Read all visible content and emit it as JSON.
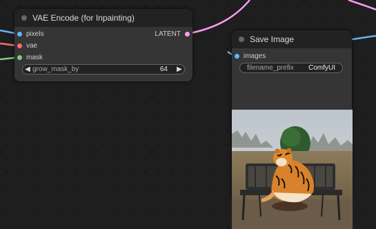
{
  "vae_node": {
    "title": "VAE Encode (for Inpainting)",
    "inputs": [
      {
        "label": "pixels",
        "color": "#64b5f6"
      },
      {
        "label": "vae",
        "color": "#ff6e6e"
      },
      {
        "label": "mask",
        "color": "#81c784"
      }
    ],
    "output": {
      "label": "LATENT",
      "color": "#ff9cf9"
    },
    "widget": {
      "label": "grow_mask_by",
      "value": "64"
    }
  },
  "save_node": {
    "title": "Save Image",
    "input": {
      "label": "images",
      "color": "#64b5f6"
    },
    "widget": {
      "label": "filename_prefix",
      "value": "ComfyUI"
    }
  },
  "colors": {
    "latent_wire": "#ff9cf9",
    "image_wire": "#64b5f6",
    "vae_wire": "#ff6e6e",
    "mask_wire": "#81c784"
  }
}
